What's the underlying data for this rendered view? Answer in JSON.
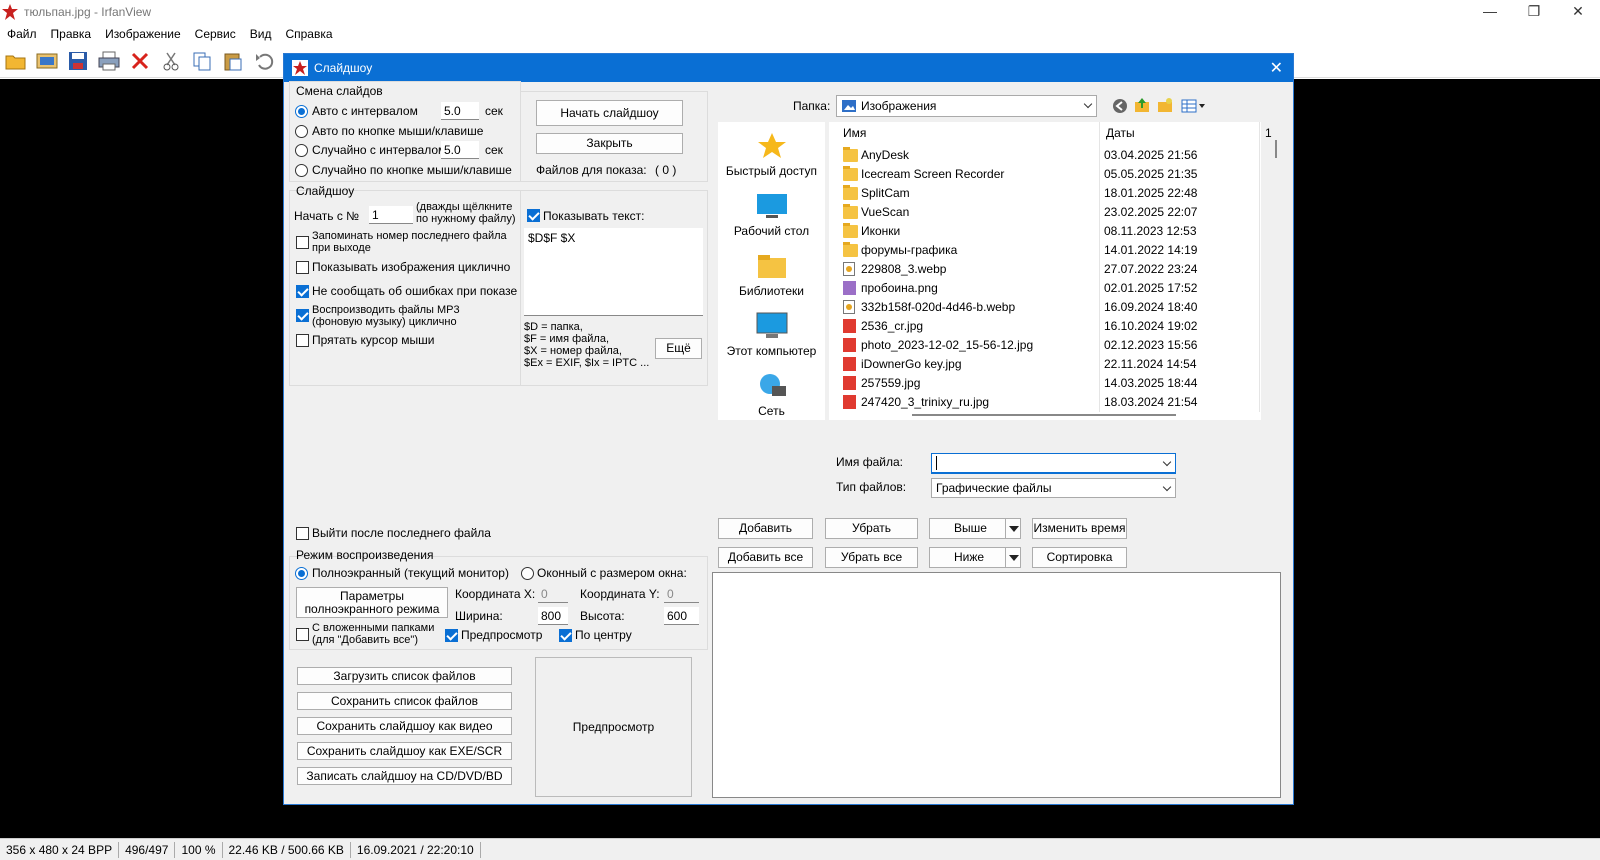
{
  "window": {
    "title": "тюльпан.jpg - IrfanView"
  },
  "menu": [
    "Файл",
    "Правка",
    "Изображение",
    "Сервис",
    "Вид",
    "Справка"
  ],
  "toolbar_icons": [
    "open-icon",
    "thumbnails-icon",
    "save-icon",
    "print-icon",
    "delete-icon",
    "cut-icon",
    "copy-icon",
    "paste-icon",
    "undo-icon"
  ],
  "status": [
    "356 x 480 x 24 BPP",
    "496/497",
    "100 %",
    "22.46 KB / 500.66 KB",
    "16.09.2021 / 22:20:10"
  ],
  "dialog": {
    "title": "Слайдшоу",
    "slide_change": {
      "label": "Смена слайдов",
      "opt_auto": "Авто с интервалом",
      "opt_auto_value": "5.0",
      "opt_mouse": "Авто по кнопке мыши/клавише",
      "opt_random": "Случайно с интервалом",
      "opt_random_value": "5.0",
      "opt_random_mouse": "Случайно по кнопке мыши/клавише",
      "sec": "сек"
    },
    "start_button": "Начать слайдшоу",
    "close_button": "Закрыть",
    "files_count_label": "Файлов для показа:",
    "files_count_value": "( 0 )",
    "slideshow": {
      "label": "Слайдшоу",
      "start_from": "Начать с №",
      "start_value": "1",
      "start_hint": "(дважды щёлкните по нужному файлу)",
      "remember": "Запоминать номер последнего файла при выходе",
      "loop": "Показывать изображения циклично",
      "no_errors": "Не сообщать об ошибках при показе",
      "mp3": "Воспроизводить файлы MP3 (фоновую музыку) циклично",
      "hide_cursor": "Прятать курсор мыши"
    },
    "show_text": {
      "label": "Показывать текст:",
      "value": "$D$F $X",
      "legend": "$D = папка,\n$F = имя файла,\n$X = номер файла,\n$Ex = EXIF, $Ix = IPTC ...",
      "more_button": "Ещё"
    },
    "exit_after_last": "Выйти после последнего файла",
    "playback": {
      "label": "Режим воспроизведения",
      "fullscreen": "Полноэкранный (текущий монитор)",
      "windowed": "Оконный с размером окна:",
      "fs_params_button": "Параметры полноэкранного режима",
      "coord_x_label": "Координата X:",
      "coord_x": "0",
      "coord_y_label": "Координата Y:",
      "coord_y": "0",
      "width_label": "Ширина:",
      "width": "800",
      "height_label": "Высота:",
      "height": "600",
      "subfolders": "С вложенными папками (для \"Добавить все\")",
      "preview": "Предпросмотр",
      "center": "По центру"
    },
    "bottom_buttons": [
      "Загрузить список файлов",
      "Сохранить список файлов",
      "Сохранить слайдшоу как видео",
      "Сохранить слайдшоу как EXE/SCR",
      "Записать слайдшоу на CD/DVD/BD"
    ],
    "preview_box": "Предпросмотр",
    "browser": {
      "folder_label": "Папка:",
      "folder_value": "Изображения",
      "places": [
        "Быстрый доступ",
        "Рабочий стол",
        "Библиотеки",
        "Этот компьютер",
        "Сеть"
      ],
      "col_name": "Имя",
      "col_date": "Даты",
      "col_extra": "1",
      "files": [
        {
          "name": "AnyDesk",
          "date": "03.04.2025 21:56",
          "type": "folder"
        },
        {
          "name": "Icecream Screen Recorder",
          "date": "05.05.2025 21:35",
          "type": "folder"
        },
        {
          "name": "SplitCam",
          "date": "18.01.2025 22:48",
          "type": "folder"
        },
        {
          "name": "VueScan",
          "date": "23.02.2025 22:07",
          "type": "folder"
        },
        {
          "name": "Иконки",
          "date": "08.11.2023 12:53",
          "type": "folder"
        },
        {
          "name": "форумы-графика",
          "date": "14.01.2022 14:19",
          "type": "folder"
        },
        {
          "name": "229808_3.webp",
          "date": "27.07.2022 23:24",
          "type": "webp"
        },
        {
          "name": "пробоина.png",
          "date": "02.01.2025 17:52",
          "type": "png"
        },
        {
          "name": "332b158f-020d-4d46-b.webp",
          "date": "16.09.2024 18:40",
          "type": "webp"
        },
        {
          "name": "2536_cr.jpg",
          "date": "16.10.2024 19:02",
          "type": "jpg"
        },
        {
          "name": "photo_2023-12-02_15-56-12.jpg",
          "date": "02.12.2023 15:56",
          "type": "jpg"
        },
        {
          "name": "iDownerGo key.jpg",
          "date": "22.11.2024 14:54",
          "type": "jpg"
        },
        {
          "name": "257559.jpg",
          "date": "14.03.2025 18:44",
          "type": "jpg"
        },
        {
          "name": "247420_3_trinixy_ru.jpg",
          "date": "18.03.2024 21:54",
          "type": "jpg"
        }
      ],
      "filename_label": "Имя файла:",
      "filename_value": "",
      "filetype_label": "Тип файлов:",
      "filetype_value": "Графические файлы"
    },
    "list_buttons": {
      "add": "Добавить",
      "remove": "Убрать",
      "up": "Выше",
      "change_time": "Изменить время",
      "add_all": "Добавить все",
      "remove_all": "Убрать все",
      "down": "Ниже",
      "sort": "Сортировка"
    }
  }
}
